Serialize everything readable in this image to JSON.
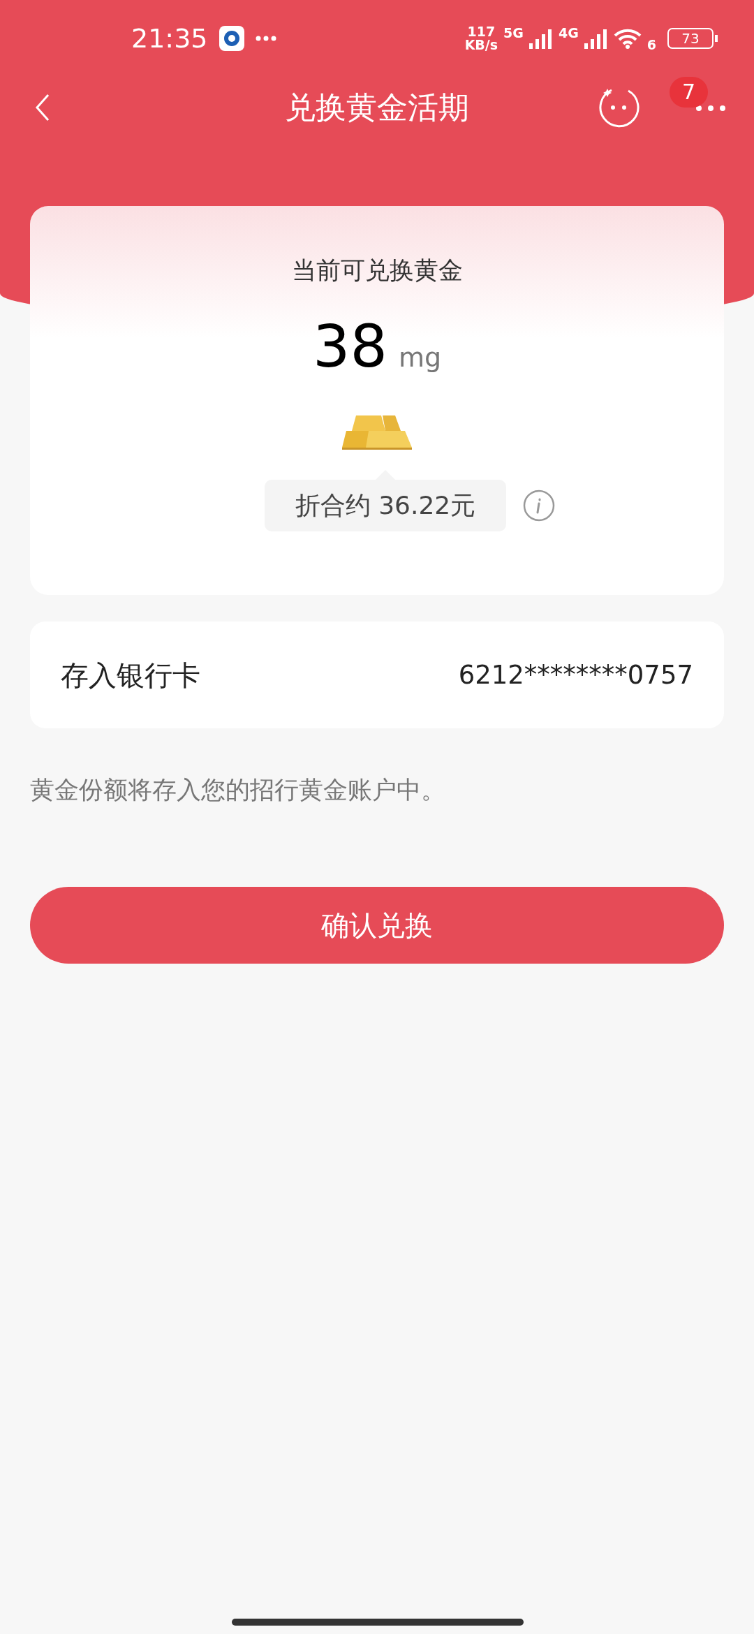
{
  "status_bar": {
    "time": "21:35",
    "speed_value": "117",
    "speed_unit": "KB/s",
    "sim1": "5G",
    "sim2": "4G",
    "wifi_label": "6",
    "battery": "73"
  },
  "header": {
    "title": "兑换黄金活期",
    "badge": "7"
  },
  "gold_card": {
    "label": "当前可兑换黄金",
    "amount": "38",
    "unit": "mg",
    "equivalent": "折合约 36.22元"
  },
  "bank_row": {
    "label": "存入银行卡",
    "value": "6212********0757"
  },
  "note": "黄金份额将存入您的招行黄金账户中。",
  "confirm_button": {
    "label": "确认兑换"
  }
}
